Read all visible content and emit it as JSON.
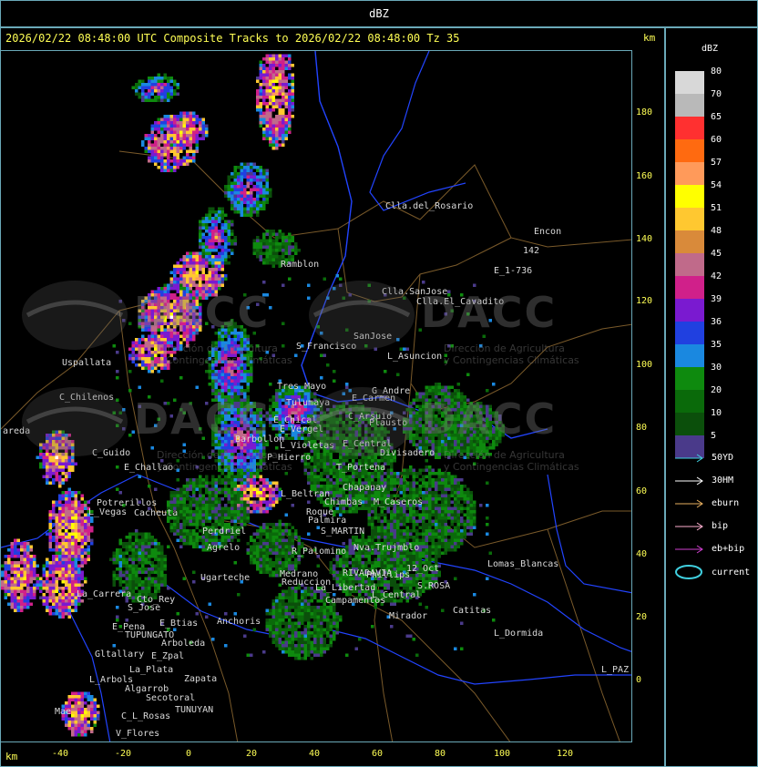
{
  "top_title": "dBZ",
  "header": "2026/02/22 08:48:00 UTC Composite Tracks to 2026/02/22 08:48:00 Tz 35",
  "unit_km": "km",
  "y_axis": {
    "ticks": [
      "180",
      "160",
      "140",
      "120",
      "100",
      "80",
      "60",
      "40",
      "20",
      "0"
    ]
  },
  "x_axis": {
    "ticks": [
      "-40",
      "-20",
      "0",
      "20",
      "40",
      "60",
      "80",
      "100",
      "120"
    ]
  },
  "legend": {
    "title": "dBZ",
    "entries": [
      {
        "label": "80",
        "color": "#d8d8d8"
      },
      {
        "label": "70",
        "color": "#b9b9b9"
      },
      {
        "label": "65",
        "color": "#ff3030"
      },
      {
        "label": "60",
        "color": "#ff6a10"
      },
      {
        "label": "57",
        "color": "#ff9a5a"
      },
      {
        "label": "54",
        "color": "#ffff00"
      },
      {
        "label": "51",
        "color": "#ffc830"
      },
      {
        "label": "48",
        "color": "#d98a3a"
      },
      {
        "label": "45",
        "color": "#c06a8a"
      },
      {
        "label": "42",
        "color": "#d0208a"
      },
      {
        "label": "39",
        "color": "#7a1ad0"
      },
      {
        "label": "36",
        "color": "#2040e0"
      },
      {
        "label": "35",
        "color": "#1a88e0"
      },
      {
        "label": "30",
        "color": "#0e8a0e"
      },
      {
        "label": "20",
        "color": "#0a6a0a"
      },
      {
        "label": "10",
        "color": "#0b4f0b"
      },
      {
        "label": "5",
        "color": "#4a3a8a"
      }
    ],
    "tracks": [
      {
        "label": "50YD",
        "color": "#40d0e0"
      },
      {
        "label": "30HM",
        "color": "#ffffff"
      },
      {
        "label": "eburn",
        "color": "#e8b060"
      },
      {
        "label": "bip",
        "color": "#ffb0d0"
      },
      {
        "label": "eb+bip",
        "color": "#d040d0"
      }
    ],
    "current_label": "current",
    "current_color": "#40d0e0"
  },
  "watermark": {
    "text": "DACC",
    "subtitle_line1": "Dirección de Agricultura",
    "subtitle_line2": "y Contingencias Climáticas"
  },
  "places": [
    {
      "name": "Clla.del_Rosario"
    },
    {
      "name": "Encon"
    },
    {
      "name": "142"
    },
    {
      "name": "E_1-736"
    },
    {
      "name": "Ramblon"
    },
    {
      "name": "Clla.SanJose"
    },
    {
      "name": "Clla.El_Cavadito"
    },
    {
      "name": "S_Francisco"
    },
    {
      "name": "SanJose"
    },
    {
      "name": "L_Asuncion"
    },
    {
      "name": "Uspallata"
    },
    {
      "name": "Tres_Mayo"
    },
    {
      "name": "G_Andre"
    },
    {
      "name": "C_Chilenos"
    },
    {
      "name": "Tulumaya"
    },
    {
      "name": "E_Carmen"
    },
    {
      "name": "E_Chical"
    },
    {
      "name": "E_Vergel"
    },
    {
      "name": "C_Arsuio"
    },
    {
      "name": "Plausto"
    },
    {
      "name": "areda"
    },
    {
      "name": "Barbollon"
    },
    {
      "name": "L_Violetas"
    },
    {
      "name": "E_Central"
    },
    {
      "name": "Divisadero"
    },
    {
      "name": "C_Guido"
    },
    {
      "name": "P_Hierro"
    },
    {
      "name": "E_Challao"
    },
    {
      "name": "T_Portena"
    },
    {
      "name": "Chapanay"
    },
    {
      "name": "L_Beltran"
    },
    {
      "name": "Chimbas"
    },
    {
      "name": "M_Caseros"
    },
    {
      "name": "Potrerillos"
    },
    {
      "name": "L_Vegas"
    },
    {
      "name": "Cacheuta"
    },
    {
      "name": "Roque"
    },
    {
      "name": "Palmira"
    },
    {
      "name": "Perdriel"
    },
    {
      "name": "S_MARTIN"
    },
    {
      "name": "Agrelo"
    },
    {
      "name": "R_Palomino"
    },
    {
      "name": "Nva.Trujmblo"
    },
    {
      "name": "12_Oct"
    },
    {
      "name": "Lomas_Blancas"
    },
    {
      "name": "Ugarteche"
    },
    {
      "name": "Medrano"
    },
    {
      "name": "RIVADAVIA"
    },
    {
      "name": "Phillips"
    },
    {
      "name": "Reduccion"
    },
    {
      "name": "La_Libertad"
    },
    {
      "name": "S.ROSA"
    },
    {
      "name": "La_Carrera"
    },
    {
      "name": "Cto_Rey"
    },
    {
      "name": "S_Jose"
    },
    {
      "name": "Campamentos"
    },
    {
      "name": "L_Central"
    },
    {
      "name": "Catitas"
    },
    {
      "name": "E_Pena"
    },
    {
      "name": "E_Btias"
    },
    {
      "name": "Anchoris"
    },
    {
      "name": "TUPUNGATO"
    },
    {
      "name": "Arboleda"
    },
    {
      "name": "Mirador"
    },
    {
      "name": "L_Dormida"
    },
    {
      "name": "Gltallary"
    },
    {
      "name": "E_Zpal"
    },
    {
      "name": "La_Plata"
    },
    {
      "name": "L_Arbols"
    },
    {
      "name": "Zapata"
    },
    {
      "name": "L_PAZ"
    },
    {
      "name": "Algarrob"
    },
    {
      "name": "Secotoral"
    },
    {
      "name": "TUNUYAN"
    },
    {
      "name": "Mae"
    },
    {
      "name": "C_L_Rosas"
    },
    {
      "name": "V_Flores"
    }
  ]
}
